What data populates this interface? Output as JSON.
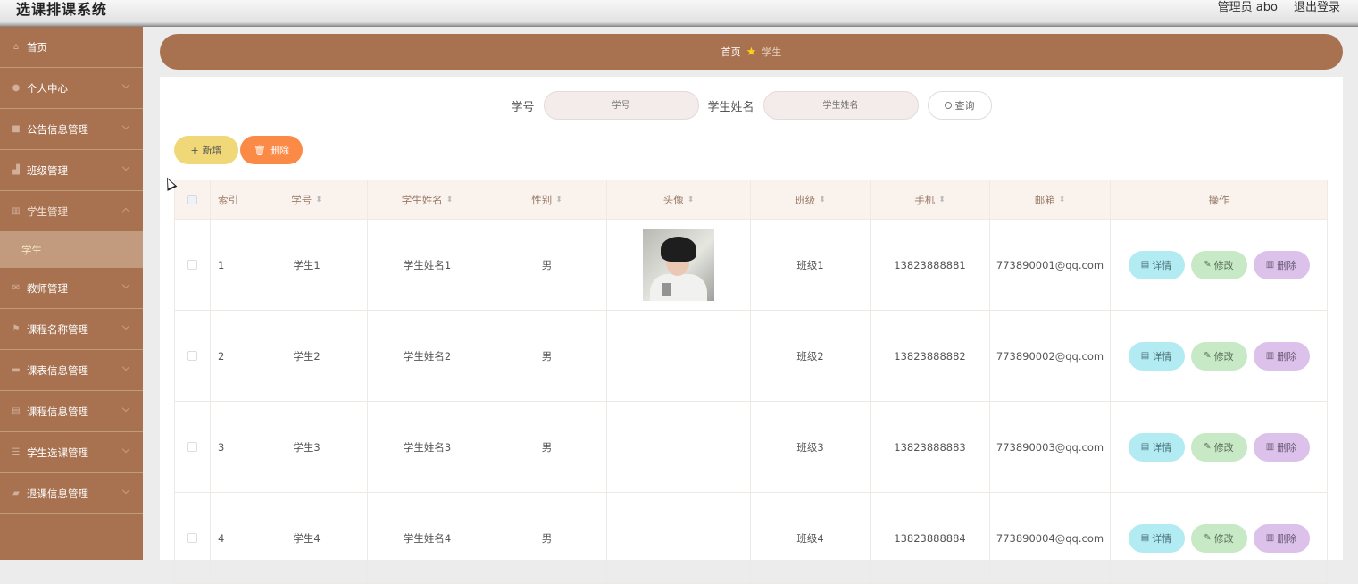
{
  "app": {
    "title": "选课排课系统",
    "user_label": "管理员 abo",
    "logout_label": "退出登录"
  },
  "sidebar": {
    "items": [
      {
        "label": "首页",
        "icon": "home-icon"
      },
      {
        "label": "个人中心",
        "icon": "user-icon"
      },
      {
        "label": "公告信息管理",
        "icon": "notice-icon"
      },
      {
        "label": "班级管理",
        "icon": "chart-icon"
      },
      {
        "label": "学生管理",
        "icon": "bar-chart-icon",
        "sub": "学生"
      },
      {
        "label": "教师管理",
        "icon": "mail-icon"
      },
      {
        "label": "课程名称管理",
        "icon": "flag-icon"
      },
      {
        "label": "课表信息管理",
        "icon": "briefcase-icon"
      },
      {
        "label": "课程信息管理",
        "icon": "document-icon"
      },
      {
        "label": "学生选课管理",
        "icon": "list-icon"
      },
      {
        "label": "退课信息管理",
        "icon": "chat-icon"
      }
    ]
  },
  "breadcrumb": {
    "home": "首页",
    "current": "学生"
  },
  "search": {
    "fields": [
      {
        "label": "学号",
        "placeholder": "学号"
      },
      {
        "label": "学生姓名",
        "placeholder": "学生姓名"
      }
    ],
    "button": "查询"
  },
  "toolbar": {
    "add": "新增",
    "delete": "删除"
  },
  "table": {
    "headers": [
      "索引",
      "学号",
      "学生姓名",
      "性别",
      "头像",
      "班级",
      "手机",
      "邮箱",
      "操作"
    ],
    "rows": [
      {
        "index": "1",
        "id": "学生1",
        "name": "学生姓名1",
        "gender": "男",
        "class": "班级1",
        "phone": "13823888881",
        "email": "773890001@qq.com"
      },
      {
        "index": "2",
        "id": "学生2",
        "name": "学生姓名2",
        "gender": "男",
        "class": "班级2",
        "phone": "13823888882",
        "email": "773890002@qq.com"
      },
      {
        "index": "3",
        "id": "学生3",
        "name": "学生姓名3",
        "gender": "男",
        "class": "班级3",
        "phone": "13823888883",
        "email": "773890003@qq.com"
      },
      {
        "index": "4",
        "id": "学生4",
        "name": "学生姓名4",
        "gender": "男",
        "class": "班级4",
        "phone": "13823888884",
        "email": "773890004@qq.com"
      }
    ],
    "row_actions": {
      "detail": "详情",
      "edit": "修改",
      "delete": "删除"
    }
  },
  "colors": {
    "brand": "#a87251",
    "add_button": "#f0d879",
    "delete_button": "#fb8a47",
    "detail_button": "#b2ebf2",
    "edit_button": "#c7e9c6",
    "remove_button": "#dcc2ea"
  }
}
